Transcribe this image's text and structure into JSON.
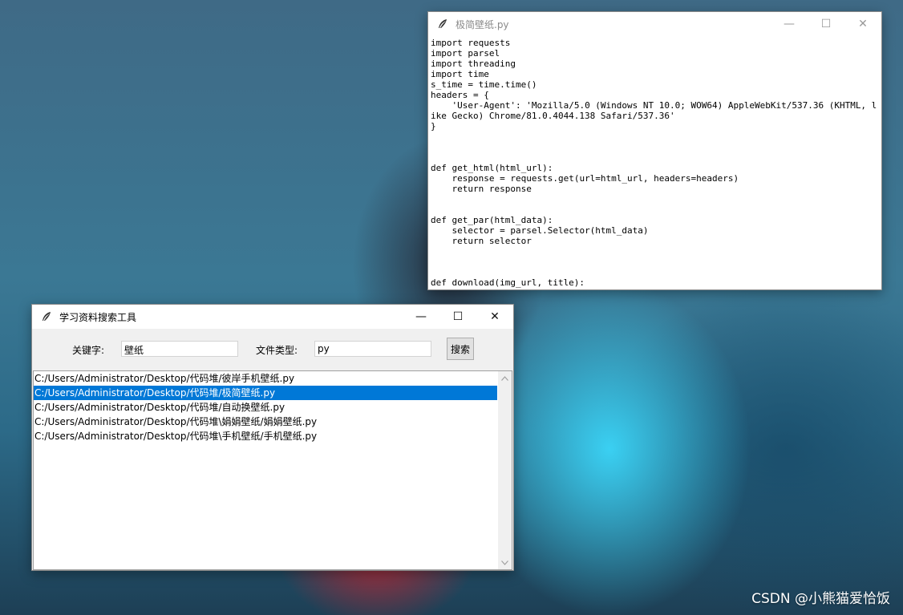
{
  "code_window": {
    "title": "极简壁纸.py",
    "code": "import requests\nimport parsel\nimport threading\nimport time\ns_time = time.time()\nheaders = {\n    'User-Agent': 'Mozilla/5.0 (Windows NT 10.0; WOW64) AppleWebKit/537.36 (KHTML, like Gecko) Chrome/81.0.4044.138 Safari/537.36'\n}\n\n\n\ndef get_html(html_url):\n    response = requests.get(url=html_url, headers=headers)\n    return response\n\n\ndef get_par(html_data):\n    selector = parsel.Selector(html_data)\n    return selector\n\n\n\ndef download(img_url, title):\n    content = get_html(img_url).content\n    path = '壁纸\\\\' + title + '.jpg'",
    "buttons": {
      "minimize": "—",
      "maximize": "☐",
      "close": "✕"
    }
  },
  "search_window": {
    "title": "学习资料搜索工具",
    "keyword_label": "关键字:",
    "keyword_value": "壁纸",
    "filetype_label": "文件类型:",
    "filetype_value": "py",
    "search_button": "搜索",
    "buttons": {
      "minimize": "—",
      "maximize": "☐",
      "close": "✕"
    },
    "results": [
      "C:/Users/Administrator/Desktop/代码堆/彼岸手机壁纸.py",
      "C:/Users/Administrator/Desktop/代码堆/极简壁纸.py",
      "C:/Users/Administrator/Desktop/代码堆/自动换壁纸.py",
      "C:/Users/Administrator/Desktop/代码堆\\娟娟壁纸/娟娟壁纸.py",
      "C:/Users/Administrator/Desktop/代码堆\\手机壁纸/手机壁纸.py"
    ],
    "selected_index": 1
  },
  "watermark": "CSDN @小熊猫爱恰饭",
  "colors": {
    "selection": "#0078d7",
    "window_bg": "#f0f0f0"
  },
  "icons": {
    "app_icon": "feather-icon"
  }
}
